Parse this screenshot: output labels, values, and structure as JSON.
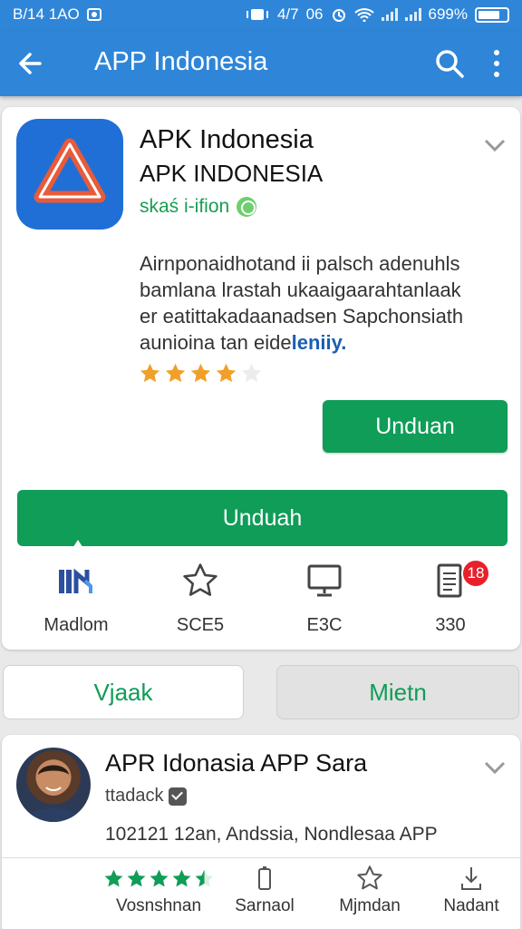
{
  "status_bar": {
    "time": "B/14 1AO",
    "network": "4/7",
    "data_label": "06",
    "battery_percent": "699%"
  },
  "app_bar": {
    "title": "APP Indonesia",
    "icons": [
      "arrow-back-icon",
      "search-icon",
      "more-vert-icon"
    ],
    "color": "#2f86d8"
  },
  "app_card": {
    "name": "APK Indonesia",
    "name_upper": "APK INDONESIA",
    "developer": "skaś i-ifion",
    "description_lines": [
      "Airnponaidhotand ii palsch adenuhls",
      "bamlana lrastah ukaaigaarahtanlaak",
      "er eatittakadaanadsen Sapchonsiath"
    ],
    "description_last": "aunioina tan eide",
    "description_link": "leniiy.",
    "rating": 4,
    "rating_max": 5,
    "install_button": "Unduan",
    "download_button": "Unduah",
    "stats": [
      {
        "icon": "chart-logo-icon",
        "label": "Madlom"
      },
      {
        "icon": "star-outline-icon",
        "label": "SCE5"
      },
      {
        "icon": "monitor-icon",
        "label": "E3C"
      },
      {
        "icon": "document-icon",
        "label": "330",
        "badge": "18"
      }
    ],
    "accent": "#0f9d58"
  },
  "tabs": [
    {
      "label": "Vjaak",
      "selected": true
    },
    {
      "label": "Mietn",
      "selected": false
    }
  ],
  "review_card": {
    "title": "APR Idonasia APP Sara",
    "subtitle": "ttadack",
    "meta": "102121 12an, Andssia, Nondlesaa APP",
    "rating": 4.5,
    "stats": [
      {
        "icon": "rating-stars-icon",
        "label": "Vosnshnan"
      },
      {
        "icon": "phone-icon",
        "label": "Sarnaol"
      },
      {
        "icon": "star-outline-icon",
        "label": "Mjmdan"
      },
      {
        "icon": "download-icon",
        "label": "Nadant"
      }
    ]
  }
}
